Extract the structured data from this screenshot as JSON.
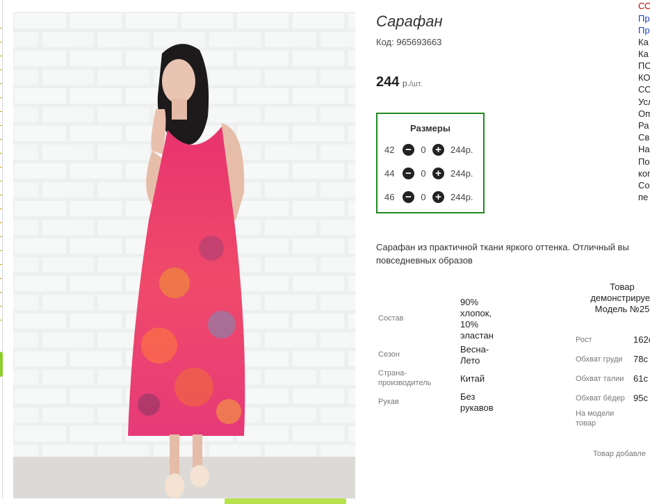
{
  "product": {
    "title": "Сарафан",
    "code_label": "Код:",
    "code_value": "965693663",
    "price_value": "244",
    "price_currency": "р.",
    "price_per": "/шт."
  },
  "sizes": {
    "title": "Размеры",
    "rows": [
      {
        "size": "42",
        "qty": "0",
        "price": "244р."
      },
      {
        "size": "44",
        "qty": "0",
        "price": "244р."
      },
      {
        "size": "46",
        "qty": "0",
        "price": "244р."
      }
    ]
  },
  "description": {
    "line1": "Сарафан из практичной ткани яркого оттенка. Отличный вы",
    "line2": "повседневных образов"
  },
  "specs": [
    {
      "label": "Состав",
      "value": [
        "90%",
        "хлопок,",
        "10%",
        "эластан"
      ]
    },
    {
      "label": "Сезон",
      "value": [
        "Весна-",
        "Лето"
      ]
    },
    {
      "label": "Страна-\nпроизводитель",
      "label_lines": [
        "Страна-",
        "производитель"
      ],
      "value": [
        "Китай"
      ]
    },
    {
      "label": "Рукав",
      "value": [
        "Без",
        "рукавов"
      ]
    }
  ],
  "model": {
    "heading": [
      "Товар",
      "демонстрирует",
      "Модель №25"
    ],
    "rows": [
      {
        "label": "Рост",
        "value": "162с"
      },
      {
        "label": "Обхват груди",
        "value": "78с"
      },
      {
        "label": "Обхват талии",
        "value": "61с"
      },
      {
        "label": "Обхват бёдер",
        "value": "95с"
      }
    ],
    "on_model_label": [
      "На модели",
      "товар"
    ],
    "added_note": "Товар добавле"
  },
  "sidebar": {
    "items": [
      {
        "text": "СО",
        "style": "red"
      },
      {
        "text": "Пр",
        "style": "blue"
      },
      {
        "text": "Пр",
        "style": "blue"
      },
      {
        "text": "Ка",
        "style": "normal"
      },
      {
        "text": "Ка",
        "style": "normal"
      },
      {
        "text": "ПО",
        "style": "normal"
      },
      {
        "text": "КО",
        "style": "normal"
      },
      {
        "text": "СО",
        "style": "normal"
      },
      {
        "text": "Усл",
        "style": "normal"
      },
      {
        "text": "Оп",
        "style": "normal"
      },
      {
        "text": "Ра",
        "style": "normal"
      },
      {
        "text": "Св",
        "style": "normal"
      },
      {
        "text": "На",
        "style": "normal"
      },
      {
        "text": "По",
        "style": "normal"
      },
      {
        "text": "ког",
        "style": "normal"
      },
      {
        "text": "Со",
        "style": "normal"
      },
      {
        "text": "пе",
        "style": "normal"
      }
    ]
  },
  "colors": {
    "sizes_border": "#1f8a1f",
    "sidebar_red": "#cc0000",
    "sidebar_blue": "#1a3fbf",
    "dress_pink": "#e8336f"
  },
  "icons": [
    "minus-circle-icon",
    "plus-circle-icon"
  ]
}
